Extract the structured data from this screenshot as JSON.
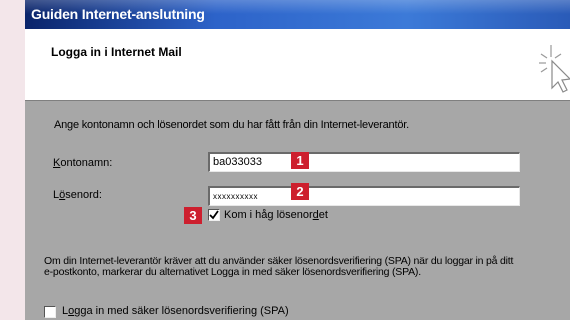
{
  "window": {
    "title": "Guiden Internet-anslutning"
  },
  "header": {
    "title": "Logga in i Internet Mail",
    "icon": "wizard-sparkle-icon"
  },
  "main": {
    "instruction": "Ange kontonamn och lösenordet som du har fått från din Internet-leverantör.",
    "account_label_hotkey": "K",
    "account_label_rest": "ontonamn:",
    "account_value": "ba033033",
    "password_label_pre": "L",
    "password_label_hotkey": "ö",
    "password_label_rest": "senord:",
    "password_masked": "xxxxxxxxxx",
    "remember_label_pre": "Kom i håg lösenor",
    "remember_label_hotkey": "d",
    "remember_label_post": "et",
    "remember_checked": true,
    "spa_description": "Om din Internet-leverantör kräver att du använder säker lösenordsverifiering (SPA) när du loggar in på ditt e-postkonto, markerar du alternativet Logga in med säker lösenordsverifiering (SPA).",
    "spa_label_pre": "L",
    "spa_label_hotkey": "o",
    "spa_label_rest": "gga in med säker lösenordsverifiering (SPA)",
    "spa_checked": false
  },
  "callouts": {
    "one": "1",
    "two": "2",
    "three": "3",
    "color": "#cd1f2e"
  },
  "colors": {
    "titlebar": "#2d63c9",
    "dialog_background": "#a7a7a7",
    "page_background": "#f3e6ea"
  }
}
